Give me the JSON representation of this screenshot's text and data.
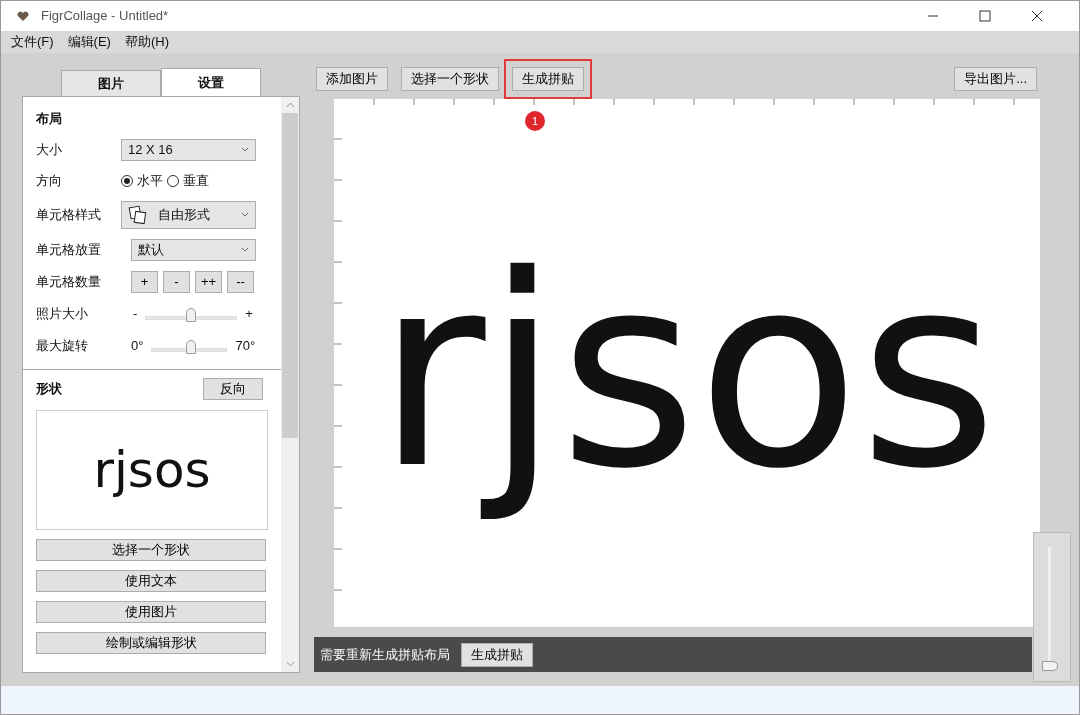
{
  "window": {
    "title": "FigrCollage - Untitled*"
  },
  "menu": [
    "文件(F)",
    "编辑(E)",
    "帮助(H)"
  ],
  "tabs": [
    {
      "label": "图片",
      "selected": false
    },
    {
      "label": "设置",
      "selected": true
    }
  ],
  "layout": {
    "heading": "布局",
    "size": {
      "label": "大小",
      "value": "12 X 16"
    },
    "orientation": {
      "label": "方向",
      "options": [
        {
          "label": "水平",
          "selected": true
        },
        {
          "label": "垂直",
          "selected": false
        }
      ]
    },
    "cell_style": {
      "label": "单元格样式",
      "value": "自由形式"
    },
    "cell_placement": {
      "label": "单元格放置",
      "value": "默认"
    },
    "cell_count": {
      "label": "单元格数量",
      "buttons": [
        "+",
        "-",
        "++",
        "--"
      ]
    },
    "photo_size": {
      "label": "照片大小",
      "min": "-",
      "max": "+",
      "level": 0.5
    },
    "max_rotation": {
      "label": "最大旋转",
      "min": "0°",
      "max": "70°",
      "level": 0.52
    }
  },
  "shape": {
    "heading": "形状",
    "reverse_button": "反向",
    "preview_text": "rjsos",
    "buttons": [
      "选择一个形状",
      "使用文本",
      "使用图片",
      "绘制或编辑形状"
    ]
  },
  "toolbar": {
    "buttons": [
      {
        "label": "添加图片",
        "highlighted": false
      },
      {
        "label": "选择一个形状",
        "highlighted": false
      },
      {
        "label": "生成拼贴",
        "highlighted": true
      }
    ],
    "export_button": "导出图片...",
    "callout": "1"
  },
  "canvas": {
    "text": "rjsos"
  },
  "notice": {
    "message": "需要重新生成拼贴布局",
    "button": "生成拼贴"
  },
  "zoom_slider": {
    "level": 0
  }
}
